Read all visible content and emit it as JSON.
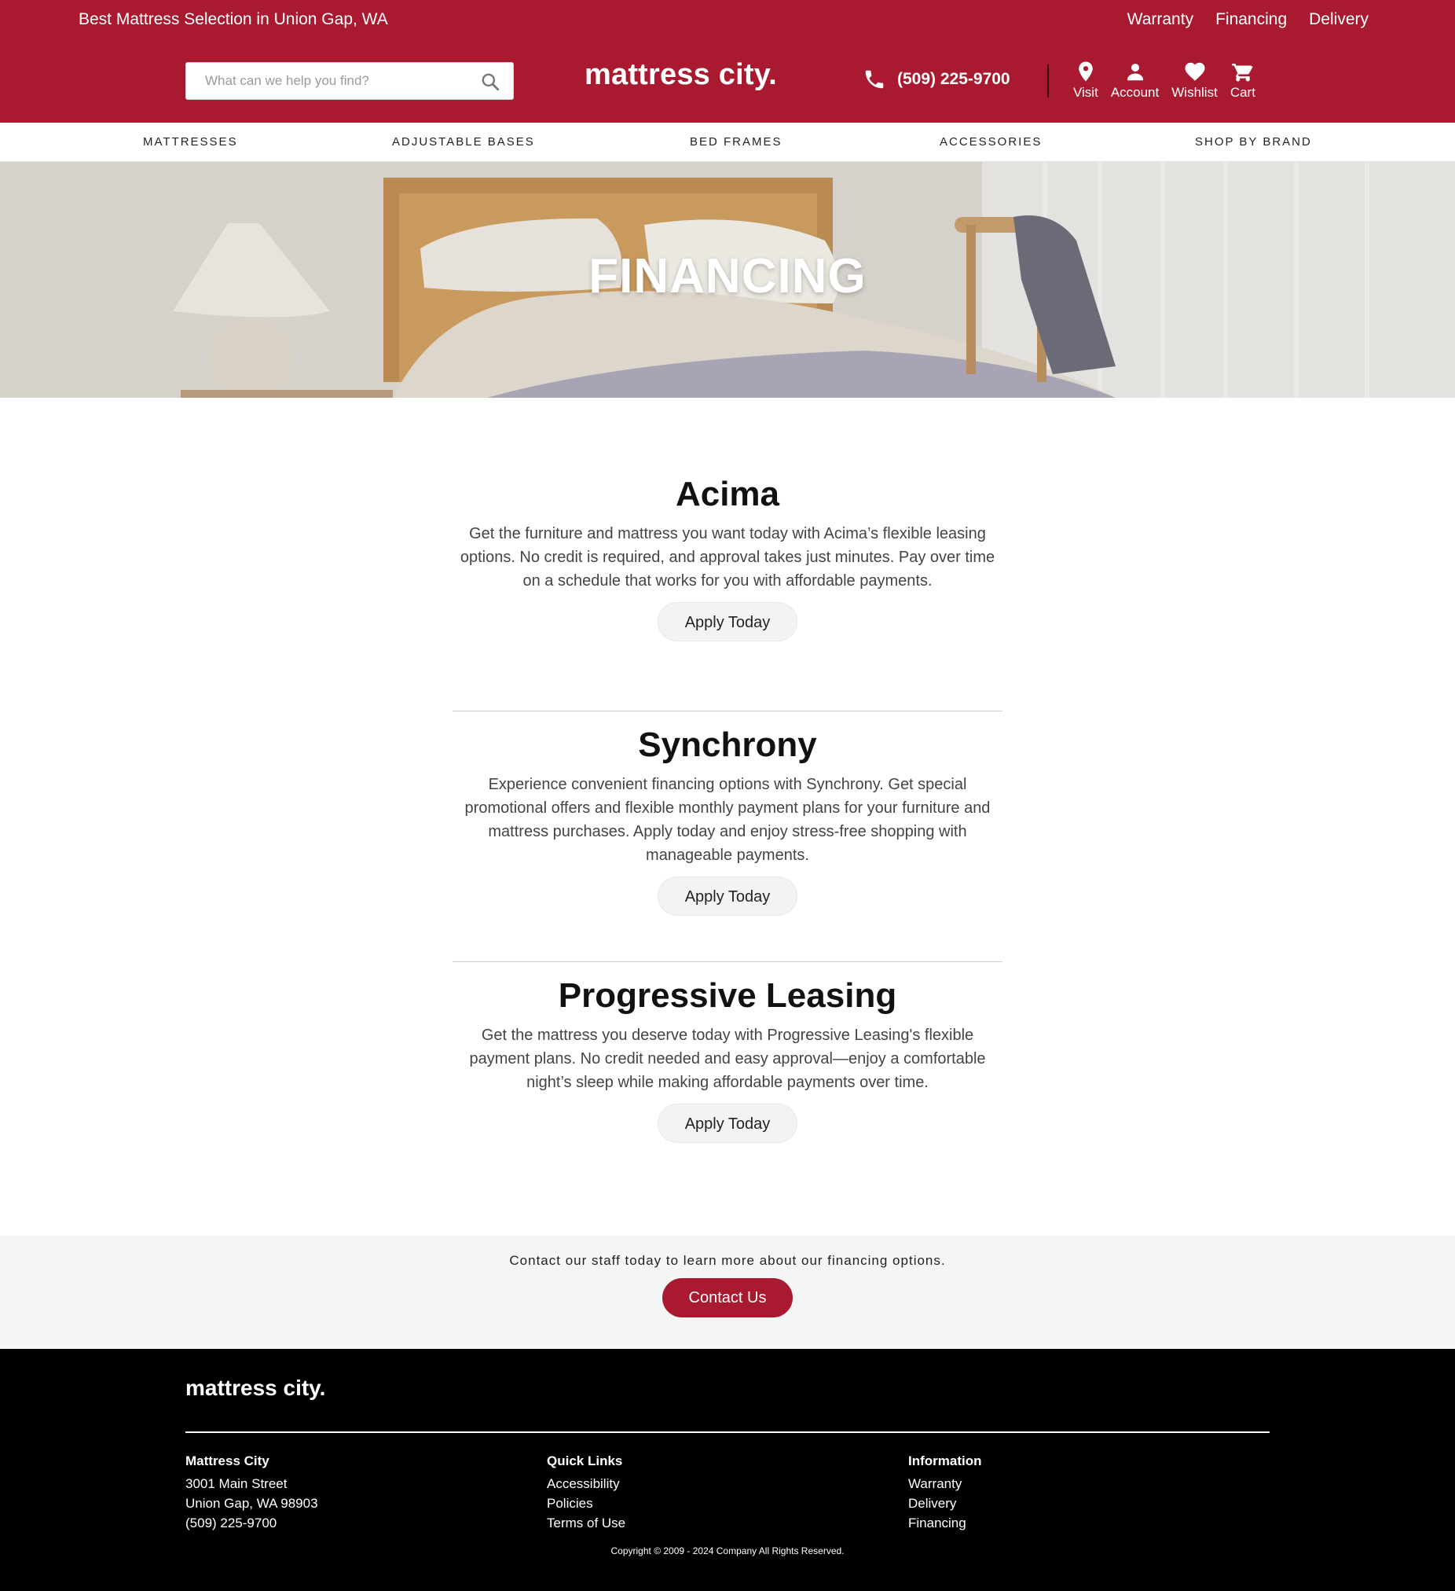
{
  "topbar": {
    "tagline": "Best Mattress Selection in Union Gap, WA",
    "links": [
      "Warranty",
      "Financing",
      "Delivery"
    ]
  },
  "header": {
    "search_placeholder": "What can we help you find?",
    "logo": "mattress city.",
    "phone": "(509) 225-9700",
    "icons": [
      {
        "label": "Visit",
        "icon": "map-pin-icon"
      },
      {
        "label": "Account",
        "icon": "user-icon"
      },
      {
        "label": "Wishlist",
        "icon": "heart-icon"
      },
      {
        "label": "Cart",
        "icon": "cart-icon"
      }
    ]
  },
  "nav": [
    "MATTRESSES",
    "ADJUSTABLE BASES",
    "BED FRAMES",
    "ACCESSORIES",
    "SHOP BY BRAND"
  ],
  "hero": {
    "title": "FINANCING"
  },
  "sections": [
    {
      "title": "Acima",
      "text": "Get the furniture and mattress you want today with Acima’s flexible leasing options. No credit is required, and approval takes just minutes. Pay over time on a schedule that works for you with affordable payments.",
      "button": "Apply Today"
    },
    {
      "title": "Synchrony",
      "text": "Experience convenient financing options with Synchrony. Get special promotional offers and flexible monthly payment plans for your furniture and mattress purchases. Apply today and enjoy stress-free shopping with manageable payments.",
      "button": "Apply Today"
    },
    {
      "title": "Progressive Leasing",
      "text": "Get the mattress you deserve today with Progressive Leasing's flexible payment plans. No credit needed and easy approval—enjoy a comfortable night’s sleep while making affordable payments over time.",
      "button": "Apply Today"
    }
  ],
  "contact": {
    "text": "Contact our staff today to learn more about our financing options.",
    "button": "Contact Us"
  },
  "footer": {
    "logo": "mattress city.",
    "columns": [
      {
        "title": "Mattress City",
        "items": [
          "3001 Main Street",
          "Union Gap, WA 98903",
          "(509) 225-9700"
        ]
      },
      {
        "title": "Quick Links",
        "items": [
          "Accessibility",
          "Policies",
          "Terms of Use"
        ]
      },
      {
        "title": "Information",
        "items": [
          "Warranty",
          "Delivery",
          "Financing"
        ]
      }
    ],
    "copyright": "Copyright © 2009 - 2024 Company All Rights Reserved."
  },
  "colors": {
    "brand_red": "#a91a30",
    "footer_bg": "#000000",
    "contact_bg": "#f4f5f5"
  }
}
